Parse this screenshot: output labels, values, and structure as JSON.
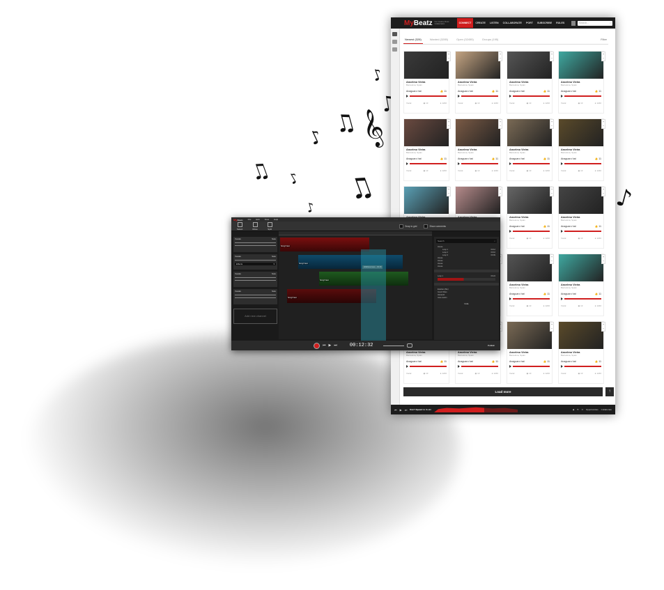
{
  "site": {
    "logo_prefix": "My",
    "logo_rest": "Beatz",
    "tagline": "For Creative Music Collaboration",
    "nav": [
      "CONNECT",
      "CREATE",
      "LISTEN",
      "COLLABORATE",
      "PORT",
      "SUBSCRIBE",
      "RULES"
    ],
    "search_placeholder": "Search..."
  },
  "tabs": {
    "items": [
      "Newest (328)",
      "Wanted (3285)",
      "Open (32455)",
      "Groups (195)"
    ],
    "filter": "Filter"
  },
  "card_template": {
    "artist": "Ancelmo Vieira",
    "location": "Barcelona, Spain",
    "song": "Anaguaro hat",
    "likes": "11",
    "tag": "Vocal",
    "views": "13",
    "members": "1240"
  },
  "cards": [
    {
      "color": "#3a3a3a"
    },
    {
      "color": "#c4a482"
    },
    {
      "color": "#555"
    },
    {
      "color": "#3fa8a0"
    },
    {
      "color": "#6a4a40"
    },
    {
      "color": "#7a5a45"
    },
    {
      "color": "#7a6a55"
    },
    {
      "color": "#5a4a2a"
    },
    {
      "color": "#5aa0b5"
    },
    {
      "color": "#b58a8a"
    },
    {
      "color": "#666"
    },
    {
      "color": "#444"
    },
    {
      "color": "#c0c0c0"
    },
    {
      "color": "#c0c0c0"
    },
    {
      "color": "#555"
    },
    {
      "color": "#3fa8a0"
    },
    {
      "color": "#c0c0c0"
    },
    {
      "color": "#c0c0c0"
    },
    {
      "color": "#7a6a55"
    },
    {
      "color": "#5a4a2a"
    }
  ],
  "load_more": "Load more",
  "to_top": "↑",
  "player": {
    "track": "Don't Speak",
    "by": "No Doubt",
    "opportunities": "Opportunities",
    "collaborate": "Collaborate"
  },
  "editor": {
    "logo_prefix": "My",
    "logo_rest": "Beatz",
    "menu": [
      "File",
      "Edit",
      "View",
      "Help"
    ],
    "tools": [
      "Select",
      "Move",
      "Split"
    ],
    "snap": "Snap to grid",
    "comments": "Show comments",
    "channels": [
      {
        "name": "Vocals",
        "solo": "Solo"
      },
      {
        "name": "Vocals",
        "solo": "Solo",
        "effects": "Effects"
      },
      {
        "name": "Vocals",
        "solo": "Solo"
      },
      {
        "name": "Vocals",
        "solo": "Solo"
      }
    ],
    "add_channel": "Add new channel",
    "clip_label": "Song Fraxo",
    "comment_label": "ADEKanonnes... 00:18",
    "search": "Search",
    "library": [
      {
        "name": "House",
        "time": ""
      },
      {
        "name": "Loop 1",
        "time": "00:12"
      },
      {
        "name": "Loop 2",
        "time": "00:16"
      },
      {
        "name": "Loop 3",
        "time": "00:09"
      },
      {
        "name": "House",
        "time": ""
      },
      {
        "name": "House",
        "time": ""
      },
      {
        "name": "House",
        "time": ""
      },
      {
        "name": "House",
        "time": ""
      }
    ],
    "loop_name": "Loop 1",
    "loop_time": "00:24",
    "users": [
      "Esteban (Me)",
      "Good Vibes",
      "Alexandr",
      "Jane Austin"
    ],
    "invite": "Invite",
    "time": "00:12:32",
    "publish": "Publish"
  }
}
